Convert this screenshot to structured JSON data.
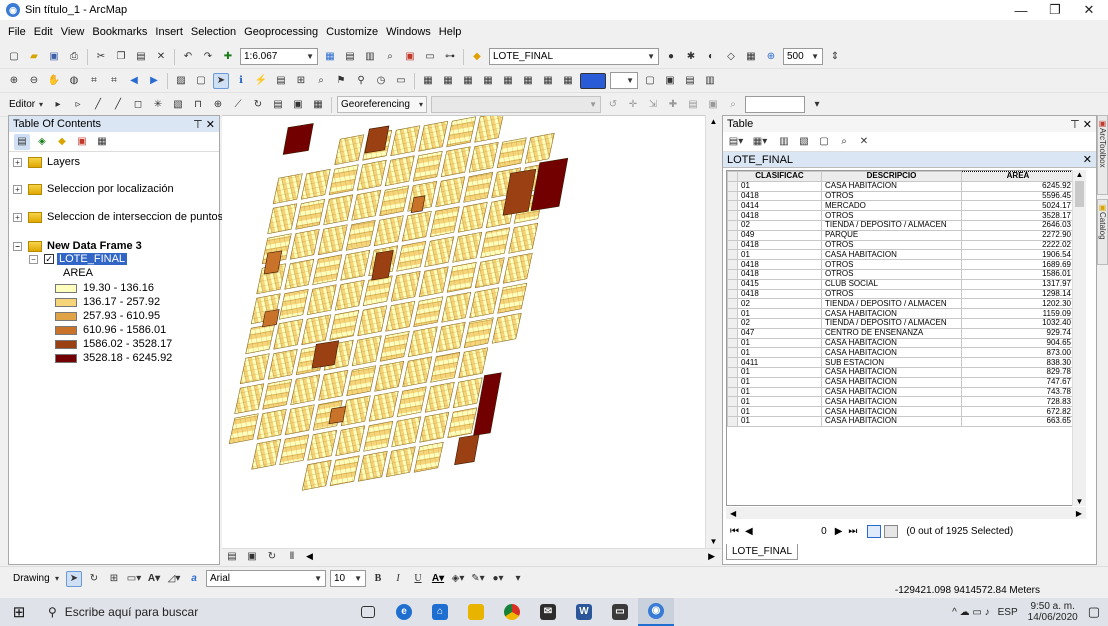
{
  "window": {
    "title": "Sin título_1 - ArcMap"
  },
  "menu": [
    "File",
    "Edit",
    "View",
    "Bookmarks",
    "Insert",
    "Selection",
    "Geoprocessing",
    "Customize",
    "Windows",
    "Help"
  ],
  "toolbar": {
    "scale": "1:6.067",
    "layer_select": "LOTE_FINAL",
    "tolerance": "500",
    "editor_label": "Editor",
    "georef_label": "Georeferencing"
  },
  "toc": {
    "title": "Table Of Contents",
    "items": [
      {
        "label": "Layers"
      },
      {
        "label": "Seleccion por localización"
      },
      {
        "label": "Seleccion de interseccion de puntos"
      },
      {
        "label": "New Data Frame 3"
      }
    ],
    "layer": {
      "name": "LOTE_FINAL",
      "field": "AREA"
    },
    "legend": [
      {
        "label": "19.30 - 136.16",
        "color": "#ffffbe"
      },
      {
        "label": "136.17 - 257.92",
        "color": "#f6d57a"
      },
      {
        "label": "257.93 - 610.95",
        "color": "#e0a447"
      },
      {
        "label": "610.96 - 1586.01",
        "color": "#c8722a"
      },
      {
        "label": "1586.02 - 3528.17",
        "color": "#9a4013"
      },
      {
        "label": "3528.18 - 6245.92",
        "color": "#730000"
      }
    ]
  },
  "table": {
    "title": "Table",
    "name": "LOTE_FINAL",
    "columns": [
      "CLASIFICAC",
      "DESCRIPCIO",
      "AREA"
    ],
    "rows": [
      [
        "01",
        "CASA HABITACION",
        "6245.92"
      ],
      [
        "0418",
        "OTROS",
        "5596.45"
      ],
      [
        "0414",
        "MERCADO",
        "5024.17"
      ],
      [
        "0418",
        "OTROS",
        "3528.17"
      ],
      [
        "02",
        "TIENDA / DEPOSITO / ALMACEN",
        "2646.03"
      ],
      [
        "049",
        "PARQUE",
        "2272.90"
      ],
      [
        "0418",
        "OTROS",
        "2222.02"
      ],
      [
        "01",
        "CASA HABITACION",
        "1906.54"
      ],
      [
        "0418",
        "OTROS",
        "1689.69"
      ],
      [
        "0418",
        "OTROS",
        "1586.01"
      ],
      [
        "0415",
        "CLUB SOCIAL",
        "1317.97"
      ],
      [
        "0418",
        "OTROS",
        "1298.14"
      ],
      [
        "02",
        "TIENDA / DEPOSITO / ALMACEN",
        "1202.30"
      ],
      [
        "01",
        "CASA HABITACION",
        "1159.09"
      ],
      [
        "02",
        "TIENDA / DEPOSITO / ALMACEN",
        "1032.40"
      ],
      [
        "047",
        "CENTRO DE ENSEÑANZA",
        "929.74"
      ],
      [
        "01",
        "CASA HABITACION",
        "904.65"
      ],
      [
        "01",
        "CASA HABITACION",
        "873.00"
      ],
      [
        "0411",
        "SUB ESTACION",
        "838.30"
      ],
      [
        "01",
        "CASA HABITACION",
        "829.78"
      ],
      [
        "01",
        "CASA HABITACION",
        "747.67"
      ],
      [
        "01",
        "CASA HABITACION",
        "743.78"
      ],
      [
        "01",
        "CASA HABITACION",
        "728.83"
      ],
      [
        "01",
        "CASA HABITACION",
        "672.82"
      ],
      [
        "01",
        "CASA HABITACION",
        "663.65"
      ]
    ],
    "nav": {
      "current": "0",
      "selection": "(0 out of 1925 Selected)"
    },
    "tab_label": "LOTE_FINAL"
  },
  "side_tabs": [
    "ArcToolbox",
    "Catalog"
  ],
  "drawing": {
    "label": "Drawing",
    "font": "Arial",
    "size": "10"
  },
  "status": {
    "coords": "-129421.098  9414572.84 Meters"
  },
  "taskbar": {
    "search_placeholder": "Escribe aquí para buscar",
    "lang": "ESP",
    "time": "9:50 a. m.",
    "date": "14/06/2020"
  }
}
